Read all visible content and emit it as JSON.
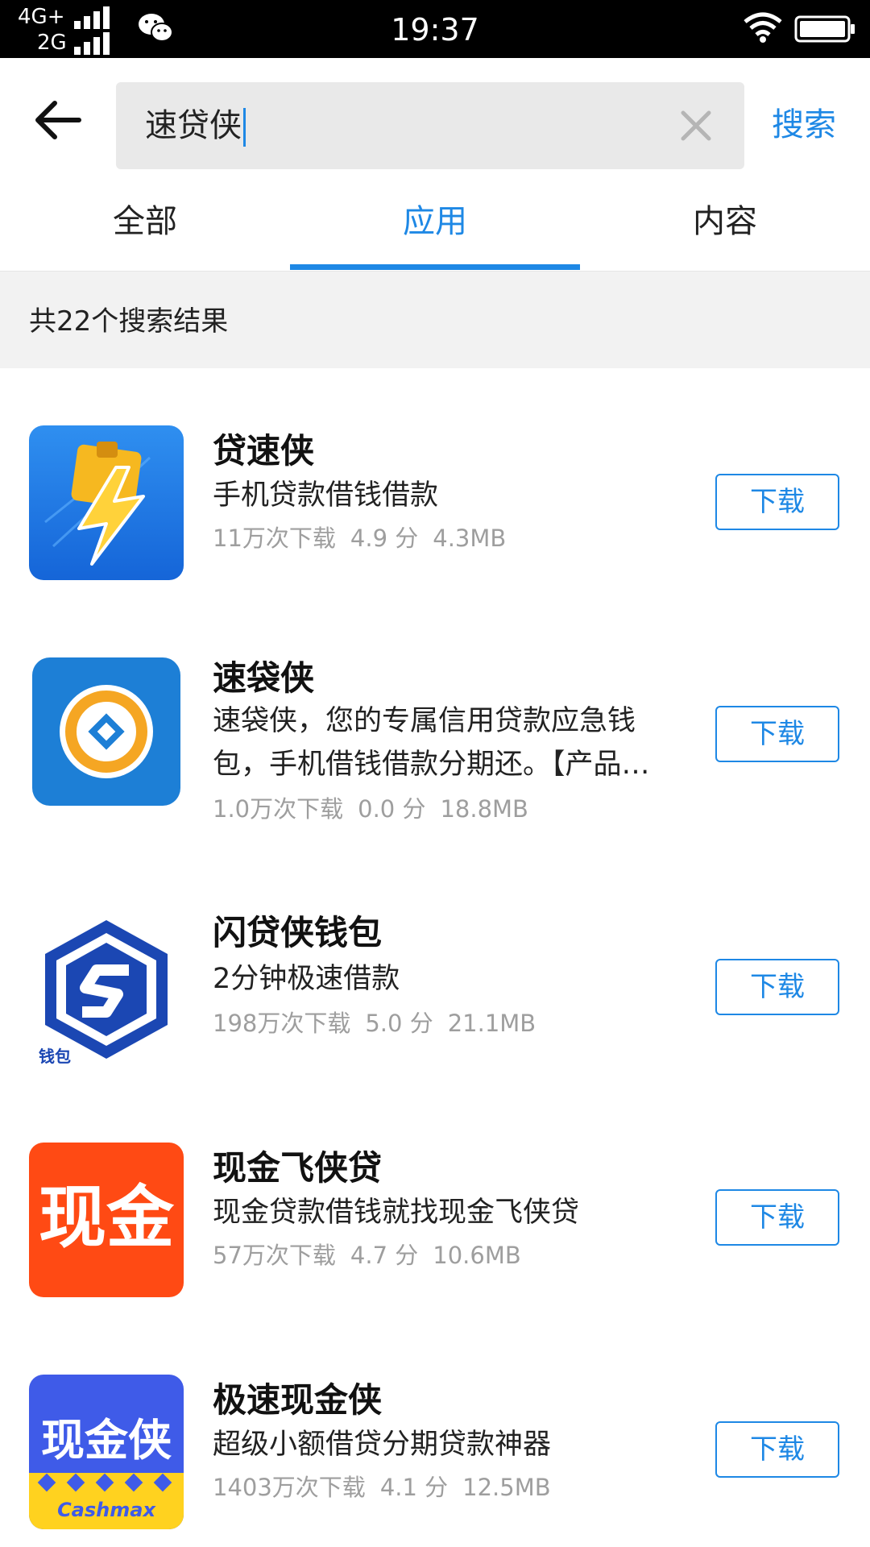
{
  "status_bar": {
    "network_1": "4G+",
    "network_2": "2G",
    "time": "19:37"
  },
  "search": {
    "query": "速贷侠",
    "button_label": "搜索"
  },
  "tabs": [
    {
      "label": "全部",
      "active": false
    },
    {
      "label": "应用",
      "active": true
    },
    {
      "label": "内容",
      "active": false
    }
  ],
  "results_count_text": "共22个搜索结果",
  "colors": {
    "accent": "#1e88e5",
    "meta_text": "#9e9e9e",
    "results_bar_bg": "#f2f2f2"
  },
  "apps": [
    {
      "name": "贷速侠",
      "description": "手机贷款借钱借款",
      "downloads": "11万次下载",
      "rating": "4.9 分",
      "size": "4.3MB",
      "button_label": "下载",
      "icon": "lightning-wallet-icon"
    },
    {
      "name": "速袋侠",
      "description": "速袋侠，您的专属信用贷款应急钱包，手机借钱借款分期还。【产品…",
      "downloads": "1.0万次下载",
      "rating": "0.0 分",
      "size": "18.8MB",
      "button_label": "下载",
      "icon": "coin-circle-icon"
    },
    {
      "name": "闪贷侠钱包",
      "description": "2分钟极速借款",
      "downloads": "198万次下载",
      "rating": "5.0 分",
      "size": "21.1MB",
      "button_label": "下载",
      "icon": "hexagon-s-icon",
      "icon_text": "钱包"
    },
    {
      "name": "现金飞侠贷",
      "description": "现金贷款借钱就找现金飞侠贷",
      "downloads": "57万次下载",
      "rating": "4.7 分",
      "size": "10.6MB",
      "button_label": "下载",
      "icon": "xianjin-text-icon",
      "icon_text": "现金"
    },
    {
      "name": "极速现金侠",
      "description": "超级小额借贷分期贷款神器",
      "downloads": "1403万次下载",
      "rating": "4.1 分",
      "size": "12.5MB",
      "button_label": "下载",
      "icon": "cashmax-icon",
      "icon_text": "现金侠",
      "icon_subtext": "Cashmax"
    }
  ]
}
